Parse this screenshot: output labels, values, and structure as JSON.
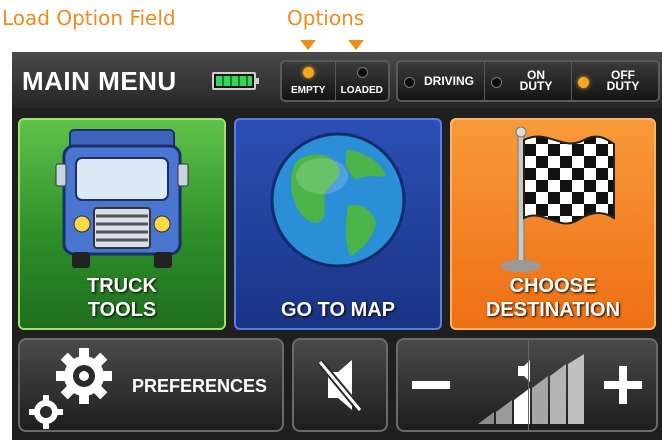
{
  "callouts": {
    "load_option_field": "Load Option Field",
    "options": "Options"
  },
  "header": {
    "title": "MAIN MENU",
    "battery_icon": "battery-full-icon"
  },
  "load_options": [
    {
      "label": "EMPTY",
      "selected": true
    },
    {
      "label": "LOADED",
      "selected": false
    }
  ],
  "duty_options": [
    {
      "label": "DRIVING",
      "selected": false
    },
    {
      "label": "ON\nDUTY",
      "selected": false
    },
    {
      "label": "OFF\nDUTY",
      "selected": true
    }
  ],
  "tiles": [
    {
      "label": "TRUCK\nTOOLS",
      "icon": "truck-icon"
    },
    {
      "label": "GO TO MAP",
      "icon": "globe-icon"
    },
    {
      "label": "CHOOSE\nDESTINATION",
      "icon": "checkered-flag-icon"
    }
  ],
  "bottom": {
    "preferences": {
      "label": "PREFERENCES",
      "icon": "gears-icon"
    },
    "mute": {
      "icon": "mute-speaker-icon"
    },
    "volume": {
      "minus": "−",
      "plus": "+",
      "icon": "volume-bars-icon"
    }
  },
  "colors": {
    "accent": "#F08A1C",
    "green_tile": "#2E8F2A",
    "blue_tile": "#1A3484",
    "orange_tile": "#EE6F14",
    "active_dot": "#F5A623"
  }
}
